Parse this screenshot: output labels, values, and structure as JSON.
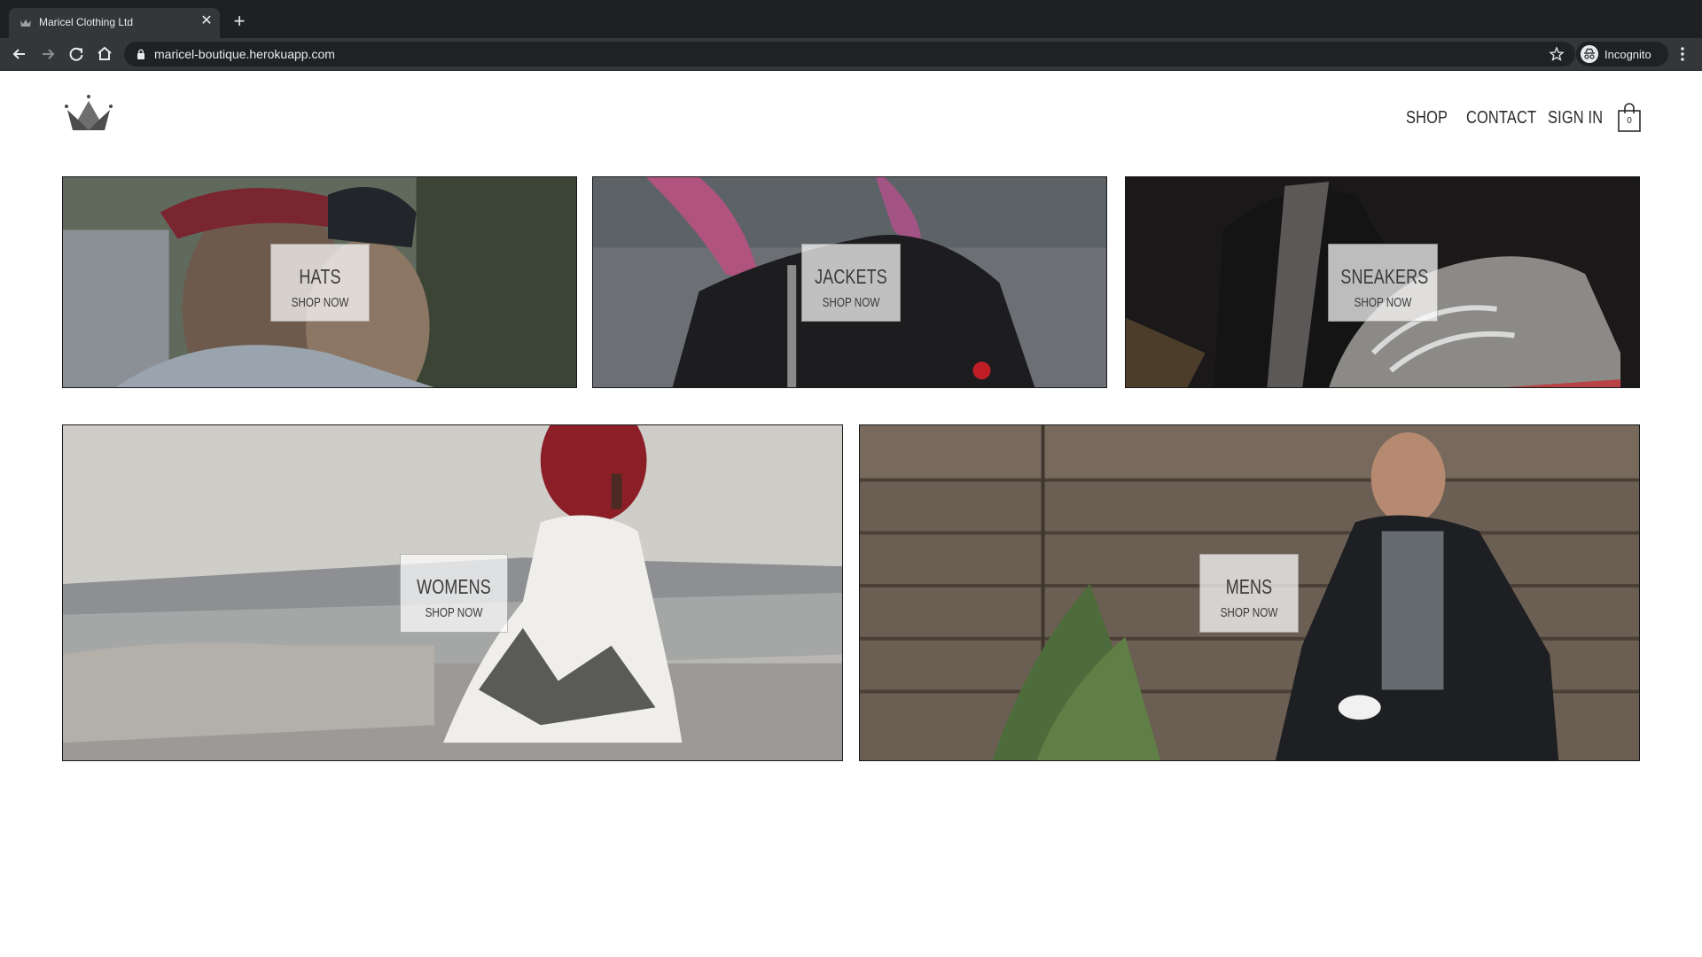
{
  "browser": {
    "tab_title": "Maricel Clothing Ltd",
    "tab_close": "✕",
    "new_tab": "+",
    "url": "maricel-boutique.herokuapp.com",
    "profile_label": "Incognito"
  },
  "header": {
    "logo_icon": "crown-icon",
    "nav": {
      "shop": "SHOP",
      "contact": "CONTACT",
      "sign_in": "SIGN IN"
    },
    "cart": {
      "icon": "shopping-bag-icon",
      "count": "0"
    }
  },
  "categories": [
    {
      "title": "HATS",
      "cta": "SHOP NOW"
    },
    {
      "title": "JACKETS",
      "cta": "SHOP NOW"
    },
    {
      "title": "SNEAKERS",
      "cta": "SHOP NOW"
    },
    {
      "title": "WOMENS",
      "cta": "SHOP NOW"
    },
    {
      "title": "MENS",
      "cta": "SHOP NOW"
    }
  ]
}
